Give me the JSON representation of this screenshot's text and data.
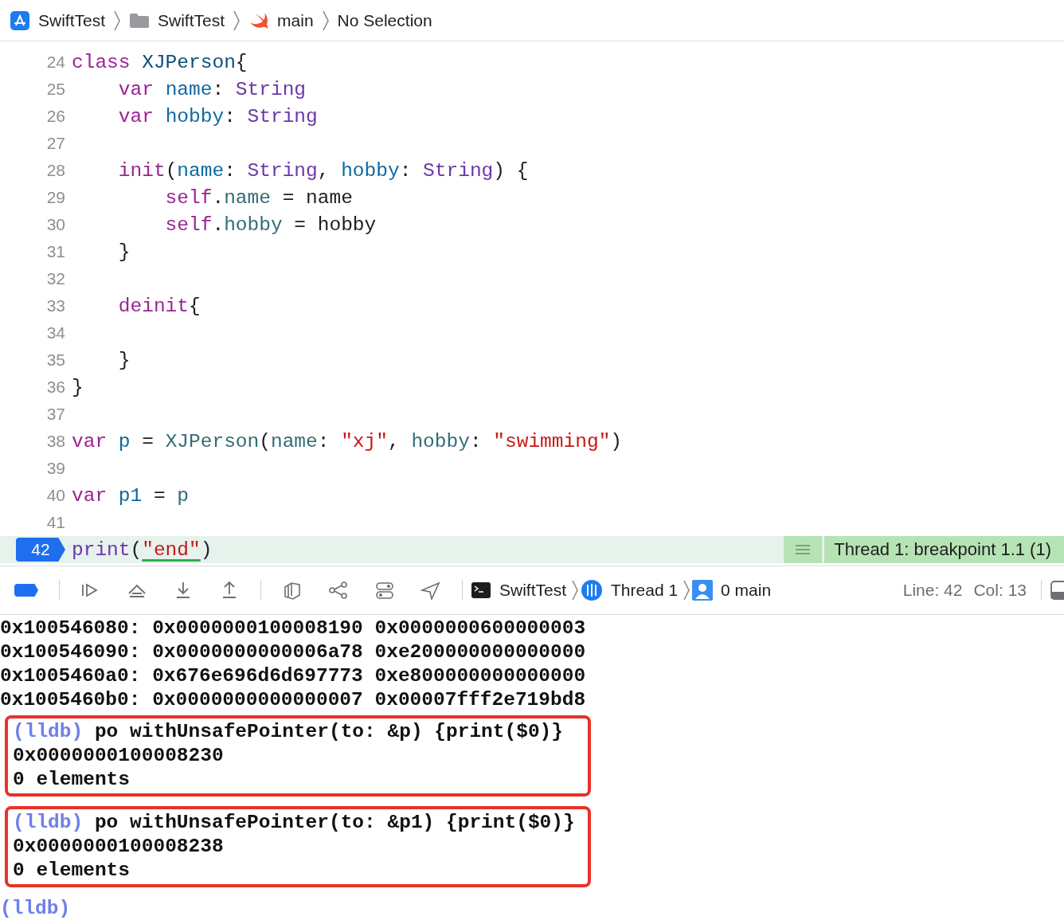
{
  "breadcrumb": [
    {
      "kind": "project",
      "text": "SwiftTest"
    },
    {
      "kind": "folder",
      "text": "SwiftTest"
    },
    {
      "kind": "swift",
      "text": "main"
    },
    {
      "kind": "plain",
      "text": "No Selection"
    }
  ],
  "editor": {
    "lines": [
      {
        "number": "24",
        "current": false,
        "tokens": [
          {
            "kind": "keyword",
            "text": "class "
          },
          {
            "kind": "decl",
            "text": "XJPerson"
          },
          {
            "kind": "plain",
            "text": "{"
          }
        ]
      },
      {
        "number": "25",
        "current": false,
        "tokens": [
          {
            "kind": "keyword",
            "text": "    var "
          },
          {
            "kind": "name",
            "text": "name"
          },
          {
            "kind": "plain",
            "text": ": "
          },
          {
            "kind": "type",
            "text": "String"
          }
        ]
      },
      {
        "number": "26",
        "current": false,
        "tokens": [
          {
            "kind": "keyword",
            "text": "    var "
          },
          {
            "kind": "name",
            "text": "hobby"
          },
          {
            "kind": "plain",
            "text": ": "
          },
          {
            "kind": "type",
            "text": "String"
          }
        ]
      },
      {
        "number": "27",
        "current": false
      },
      {
        "number": "28",
        "current": false,
        "tokens": [
          {
            "kind": "keyword",
            "text": "    init"
          },
          {
            "kind": "plain",
            "text": "("
          },
          {
            "kind": "name",
            "text": "name"
          },
          {
            "kind": "plain",
            "text": ": "
          },
          {
            "kind": "type",
            "text": "String"
          },
          {
            "kind": "plain",
            "text": ", "
          },
          {
            "kind": "name",
            "text": "hobby"
          },
          {
            "kind": "plain",
            "text": ": "
          },
          {
            "kind": "type",
            "text": "String"
          },
          {
            "kind": "plain",
            "text": ") {"
          }
        ]
      },
      {
        "number": "29",
        "current": false,
        "tokens": [
          {
            "kind": "keyword",
            "text": "        self"
          },
          {
            "kind": "plain",
            "text": "."
          },
          {
            "kind": "property",
            "text": "name"
          },
          {
            "kind": "plain",
            "text": " = name"
          }
        ]
      },
      {
        "number": "30",
        "current": false,
        "tokens": [
          {
            "kind": "keyword",
            "text": "        self"
          },
          {
            "kind": "plain",
            "text": "."
          },
          {
            "kind": "property",
            "text": "hobby"
          },
          {
            "kind": "plain",
            "text": " = hobby"
          }
        ]
      },
      {
        "number": "31",
        "current": false,
        "tokens": [
          {
            "kind": "plain",
            "text": "    }"
          }
        ]
      },
      {
        "number": "32",
        "current": false
      },
      {
        "number": "33",
        "current": false,
        "tokens": [
          {
            "kind": "keyword",
            "text": "    deinit"
          },
          {
            "kind": "plain",
            "text": "{"
          }
        ]
      },
      {
        "number": "34",
        "current": false
      },
      {
        "number": "35",
        "current": false,
        "tokens": [
          {
            "kind": "plain",
            "text": "    }"
          }
        ]
      },
      {
        "number": "36",
        "current": false,
        "tokens": [
          {
            "kind": "plain",
            "text": "}"
          }
        ]
      },
      {
        "number": "37",
        "current": false
      },
      {
        "number": "38",
        "current": false,
        "tokens": [
          {
            "kind": "keyword",
            "text": "var "
          },
          {
            "kind": "name",
            "text": "p"
          },
          {
            "kind": "plain",
            "text": " = "
          },
          {
            "kind": "call",
            "text": "XJPerson"
          },
          {
            "kind": "plain",
            "text": "("
          },
          {
            "kind": "call",
            "text": "name"
          },
          {
            "kind": "plain",
            "text": ": "
          },
          {
            "kind": "string",
            "text": "\"xj\""
          },
          {
            "kind": "plain",
            "text": ", "
          },
          {
            "kind": "call",
            "text": "hobby"
          },
          {
            "kind": "plain",
            "text": ": "
          },
          {
            "kind": "string",
            "text": "\"swimming\""
          },
          {
            "kind": "plain",
            "text": ")"
          }
        ]
      },
      {
        "number": "39",
        "current": false
      },
      {
        "number": "40",
        "current": false,
        "tokens": [
          {
            "kind": "keyword",
            "text": "var "
          },
          {
            "kind": "name",
            "text": "p1"
          },
          {
            "kind": "plain",
            "text": " = "
          },
          {
            "kind": "call",
            "text": "p"
          }
        ]
      },
      {
        "number": "41",
        "current": false
      },
      {
        "number": "42",
        "current": true,
        "tokens": [
          {
            "kind": "type",
            "text": "print"
          },
          {
            "kind": "plain",
            "text": "("
          },
          {
            "kind": "string",
            "text": "\"end\"",
            "underlined": true
          },
          {
            "kind": "plain",
            "text": ")"
          }
        ],
        "annotation": "Thread 1: breakpoint 1.1 (1)"
      }
    ]
  },
  "debug_bar": {
    "breakpoints_active": true,
    "path": [
      {
        "kind": "target",
        "text": "SwiftTest"
      },
      {
        "kind": "thread",
        "text": "Thread 1"
      },
      {
        "kind": "frame",
        "text": "0 main"
      }
    ],
    "line": "Line: 42",
    "col": "Col: 13"
  },
  "console": {
    "blocks": [
      {
        "framed": false,
        "lines": [
          {
            "kind": "output",
            "text": "0x100546080: 0x0000000100008190 0x0000000600000003"
          },
          {
            "kind": "output",
            "text": "0x100546090: 0x0000000000006a78 0xe200000000000000"
          },
          {
            "kind": "output",
            "text": "0x1005460a0: 0x676e696d6d697773 0xe800000000000000"
          },
          {
            "kind": "output",
            "text": "0x1005460b0: 0x0000000000000007 0x00007fff2e719bd8"
          }
        ]
      },
      {
        "framed": true,
        "lines": [
          {
            "kind": "prompt",
            "prompt": "(lldb)",
            "text": "po withUnsafePointer(to: &p) {print($0)}"
          },
          {
            "kind": "output",
            "text": "0x0000000100008230"
          },
          {
            "kind": "output",
            "text": "0 elements"
          }
        ]
      },
      {
        "framed": true,
        "lines": [
          {
            "kind": "prompt",
            "prompt": "(lldb)",
            "text": "po withUnsafePointer(to: &p1) {print($0)}"
          },
          {
            "kind": "output",
            "text": "0x0000000100008238"
          },
          {
            "kind": "output",
            "text": "0 elements"
          }
        ]
      },
      {
        "framed": false,
        "lines": [
          {
            "kind": "prompt",
            "prompt": "(lldb)"
          }
        ]
      }
    ]
  }
}
